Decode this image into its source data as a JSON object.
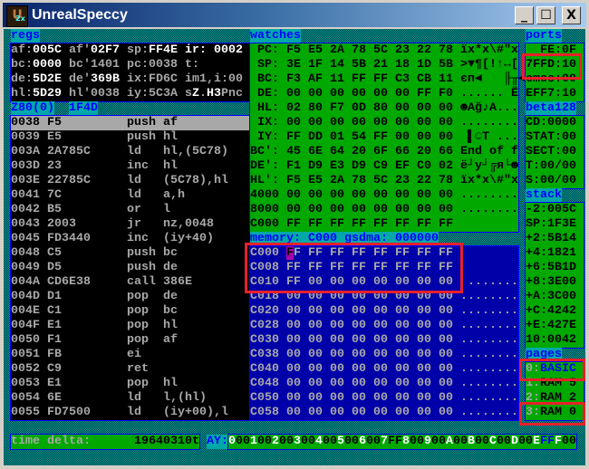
{
  "window": {
    "title": "UnrealSpeccy",
    "icon_text": "U",
    "icon_sub": "2x",
    "minimize": "_",
    "maximize": "☐",
    "close": "X"
  },
  "regs": {
    "label": "regs",
    "lines": [
      [
        [
          "af:",
          "l"
        ],
        [
          "005C",
          "v"
        ],
        [
          " af'",
          "l"
        ],
        [
          "02F7",
          "v"
        ],
        [
          " sp:",
          "l"
        ],
        [
          "FF4E",
          "v"
        ],
        [
          " ir: 0002",
          "v"
        ]
      ],
      [
        [
          "bc:",
          "l"
        ],
        [
          "0000",
          "v"
        ],
        [
          " bc'1401 pc:0038 t:       13",
          "l"
        ]
      ],
      [
        [
          "de:",
          "l"
        ],
        [
          "5D2E",
          "v"
        ],
        [
          " de'",
          "l"
        ],
        [
          "369B",
          "v"
        ],
        [
          " ix:FD6C im1,i:00",
          "l"
        ]
      ],
      [
        [
          "hl:",
          "l"
        ],
        [
          "5D29",
          "v"
        ],
        [
          " hl'0038 iy:5C3A s",
          "l"
        ],
        [
          "Z",
          "v"
        ],
        [
          ".",
          "l"
        ],
        [
          "H3",
          "v"
        ],
        [
          "Pnc",
          "l"
        ]
      ]
    ]
  },
  "cpu": {
    "label": "Z80(0)",
    "addr": "1F4D"
  },
  "disasm": {
    "selected": 0,
    "rows": [
      {
        "addr": "0038",
        "bytes": "F5",
        "mnem": "push",
        "ops": "af"
      },
      {
        "addr": "0039",
        "bytes": "E5",
        "mnem": "push",
        "ops": "hl"
      },
      {
        "addr": "003A",
        "bytes": "2A785C",
        "mnem": "ld",
        "ops": "hl,(5C78)"
      },
      {
        "addr": "003D",
        "bytes": "23",
        "mnem": "inc",
        "ops": "hl"
      },
      {
        "addr": "003E",
        "bytes": "22785C",
        "mnem": "ld",
        "ops": "(5C78),hl"
      },
      {
        "addr": "0041",
        "bytes": "7C",
        "mnem": "ld",
        "ops": "a,h"
      },
      {
        "addr": "0042",
        "bytes": "B5",
        "mnem": "or",
        "ops": "l"
      },
      {
        "addr": "0043",
        "bytes": "2003",
        "mnem": "jr",
        "ops": "nz,0048"
      },
      {
        "addr": "0045",
        "bytes": "FD3440",
        "mnem": "inc",
        "ops": "(iy+40)"
      },
      {
        "addr": "0048",
        "bytes": "C5",
        "mnem": "push",
        "ops": "bc"
      },
      {
        "addr": "0049",
        "bytes": "D5",
        "mnem": "push",
        "ops": "de"
      },
      {
        "addr": "004A",
        "bytes": "CD6E38",
        "mnem": "call",
        "ops": "386E"
      },
      {
        "addr": "004D",
        "bytes": "D1",
        "mnem": "pop",
        "ops": "de"
      },
      {
        "addr": "004E",
        "bytes": "C1",
        "mnem": "pop",
        "ops": "bc"
      },
      {
        "addr": "004F",
        "bytes": "E1",
        "mnem": "pop",
        "ops": "hl"
      },
      {
        "addr": "0050",
        "bytes": "F1",
        "mnem": "pop",
        "ops": "af"
      },
      {
        "addr": "0051",
        "bytes": "FB",
        "mnem": "ei",
        "ops": ""
      },
      {
        "addr": "0052",
        "bytes": "C9",
        "mnem": "ret",
        "ops": ""
      },
      {
        "addr": "0053",
        "bytes": "E1",
        "mnem": "pop",
        "ops": "hl"
      },
      {
        "addr": "0054",
        "bytes": "6E",
        "mnem": "ld",
        "ops": "l,(hl)"
      },
      {
        "addr": "0055",
        "bytes": "FD7500",
        "mnem": "ld",
        "ops": "(iy+00),l"
      }
    ]
  },
  "watches": {
    "label": "watches",
    "rows": [
      {
        "name": " PC:",
        "bytes": "F5 E5 2A 78 5C 23 22 78",
        "ascii": "ïx*x\\#\"x"
      },
      {
        "name": " SP:",
        "bytes": "3E 1F 14 5B 21 18 1D 5B",
        "ascii": ">▼¶[!↑↔["
      },
      {
        "name": " BC:",
        "bytes": "F3 AF 11 FF FF C3 CB 11",
        "ascii": "єп◄   ╟╥◄"
      },
      {
        "name": " DE:",
        "bytes": "00 00 00 00 00 00 FF F0",
        "ascii": "...... Ë"
      },
      {
        "name": " HL:",
        "bytes": "02 80 F7 0D 80 00 00 00",
        "ascii": "☻Ağ♪A..."
      },
      {
        "name": " IX:",
        "bytes": "00 00 00 00 00 00 00 00",
        "ascii": "........"
      },
      {
        "name": " IY:",
        "bytes": "FF DD 01 54 FF 00 00 00",
        "ascii": " ▌☺T ..."
      },
      {
        "name": "BC':",
        "bytes": "45 6E 64 20 6F 66 20 66",
        "ascii": "End of f"
      },
      {
        "name": "DE':",
        "bytes": "F1 D9 E3 D9 C9 EF C0 02",
        "ascii": "ë┘y┘╔я└☻"
      },
      {
        "name": "HL':",
        "bytes": "F5 E5 2A 78 5C 23 22 78",
        "ascii": "ïx*x\\#\"x"
      },
      {
        "name": "4000",
        "bytes": "00 00 00 00 00 00 00 00",
        "ascii": "........"
      },
      {
        "name": "8000",
        "bytes": "00 00 00 00 00 00 00 00",
        "ascii": "........"
      },
      {
        "name": "C000",
        "bytes": "FF FF FF FF FF FF FF FF",
        "ascii": ""
      }
    ]
  },
  "memory": {
    "label": "memory: C000 gsdma: 000000",
    "rows": [
      {
        "addr": "C000",
        "bytes": "FF FF FF FF FF FF FF FF",
        "ascii": ""
      },
      {
        "addr": "C008",
        "bytes": "FF FF FF FF FF FF FF FF",
        "ascii": ""
      },
      {
        "addr": "C010",
        "bytes": "FF 00 00 00 00 00 00 00",
        "ascii": " ......."
      },
      {
        "addr": "C018",
        "bytes": "00 00 00 00 00 00 00 00",
        "ascii": "........"
      },
      {
        "addr": "C020",
        "bytes": "00 00 00 00 00 00 00 00",
        "ascii": "........"
      },
      {
        "addr": "C028",
        "bytes": "00 00 00 00 00 00 00 00",
        "ascii": "........"
      },
      {
        "addr": "C030",
        "bytes": "00 00 00 00 00 00 00 00",
        "ascii": "........"
      },
      {
        "addr": "C038",
        "bytes": "00 00 00 00 00 00 00 00",
        "ascii": "........"
      },
      {
        "addr": "C040",
        "bytes": "00 00 00 00 00 00 00 00",
        "ascii": "........"
      },
      {
        "addr": "C048",
        "bytes": "00 00 00 00 00 00 00 00",
        "ascii": "........"
      },
      {
        "addr": "C050",
        "bytes": "00 00 00 00 00 00 00 00",
        "ascii": "........"
      },
      {
        "addr": "C058",
        "bytes": "00 00 00 00 00 00 00 00",
        "ascii": "........"
      }
    ]
  },
  "ports": {
    "label": "ports",
    "rows": [
      "  FE:0F",
      "7FFD:10",
      "cmos:00",
      "EFF7:10"
    ]
  },
  "beta128": {
    "label": "beta128",
    "rows": [
      "CD:0000",
      "STAT:00",
      "SECT:00",
      "T:00/00",
      "S:00/00"
    ]
  },
  "stack": {
    "label": "stack",
    "rows": [
      "-2:005C",
      "SP:1F3E",
      "+2:5B14",
      "+4:1821",
      "+6:5B1D",
      "+8:3E00",
      "+A:3C00",
      "+C:4242",
      "+E:427E",
      "10:0042"
    ]
  },
  "pages": {
    "label": "pages",
    "rows": [
      {
        "num": "0:",
        "name": "BASIC",
        "active": true
      },
      {
        "num": "1:",
        "name": "RAM 5",
        "active": false
      },
      {
        "num": "2:",
        "name": "RAM 2",
        "active": false
      },
      {
        "num": "3:",
        "name": "RAM 0",
        "active": false
      }
    ]
  },
  "status": {
    "time_label": "time delta:",
    "time_value": "19640310t",
    "ay_label": "AY:",
    "ay": [
      {
        "reg": "0",
        "val": "00"
      },
      {
        "reg": "1",
        "val": "00"
      },
      {
        "reg": "2",
        "val": "00"
      },
      {
        "reg": "3",
        "val": "00"
      },
      {
        "reg": "4",
        "val": "00"
      },
      {
        "reg": "5",
        "val": "00"
      },
      {
        "reg": "6",
        "val": "00"
      },
      {
        "reg": "7",
        "val": "FF"
      },
      {
        "reg": "8",
        "val": "00"
      },
      {
        "reg": "9",
        "val": "00"
      },
      {
        "reg": "A",
        "val": "00"
      },
      {
        "reg": "B",
        "val": "00"
      },
      {
        "reg": "C",
        "val": "00"
      },
      {
        "reg": "D",
        "val": "00"
      },
      {
        "reg": "E",
        "val": "FF",
        "hl": true
      },
      {
        "reg": "F",
        "val": "00"
      }
    ]
  },
  "colors": {
    "screen_teal": "#00a8a8",
    "panel_green": "#00a800",
    "memory_blue": "#0000a8",
    "annotation_red": "#e8202a"
  }
}
